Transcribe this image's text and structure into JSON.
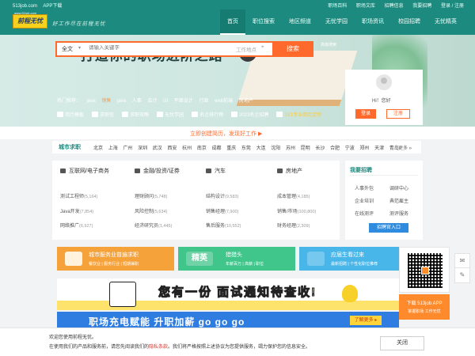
{
  "topbar": {
    "left": [
      "513job.com",
      "APP下载"
    ],
    "right": [
      "职场百科",
      "职场文库",
      "招聘信息",
      "我要招聘",
      "登录 / 注册"
    ]
  },
  "brand": {
    "url": "www.51job.com",
    "logo": "前程无忧",
    "slogan": "好工作尽在前程无忧"
  },
  "nav": [
    "首页",
    "职位搜索",
    "地区频道",
    "无忧学园",
    "职场资讯",
    "校园招聘",
    "无忧精英"
  ],
  "hero": {
    "title": "°打造你的职场进阶之路",
    "go": "Go",
    "search": {
      "category": "全文",
      "placeholder": "请输入关键字",
      "location": "工作地点",
      "button": "搜索",
      "advanced": "高级搜索"
    },
    "hot_label": "热门推荐：",
    "hot": [
      "java",
      "销售",
      "java",
      "人事",
      "会计",
      "UI",
      "平面设计",
      "行政",
      "web前端",
      "房地产"
    ],
    "hot_highlight_index": 1,
    "tools": [
      "简历模板",
      "求职信",
      "求职攻略",
      "无忧学园",
      "名企排行榜",
      "2023名企招聘",
      "1V1专业简历定制"
    ]
  },
  "login_card": {
    "greeting": "Hi！您好",
    "login": "登录",
    "register": "注册"
  },
  "create_resume": "立即创建简历，发现好工作 ▶",
  "cities": {
    "title": "城市求职",
    "list": [
      "北京",
      "上海",
      "广州",
      "深圳",
      "武汉",
      "西安",
      "杭州",
      "南京",
      "成都",
      "重庆",
      "东莞",
      "大连",
      "沈阳",
      "苏州",
      "昆明",
      "长沙",
      "合肥",
      "宁波",
      "郑州",
      "天津",
      "青岛"
    ],
    "more": "更多 »"
  },
  "industries": [
    {
      "name": "互联网/电子商务",
      "jobs": [
        [
          "测试工程师",
          "(5,164)"
        ],
        [
          "Java开发",
          "(7,854)"
        ],
        [
          "网络推广",
          "(6,927)"
        ]
      ]
    },
    {
      "name": "金融/投资/证券",
      "jobs": [
        [
          "理财顾问",
          "(5,748)"
        ],
        [
          "风险控制",
          "(5,634)"
        ],
        [
          "经济研究员",
          "(1,445)"
        ]
      ]
    },
    {
      "name": "汽车",
      "jobs": [
        [
          "结构设计",
          "(9,583)"
        ],
        [
          "销售经理",
          "(7,900)"
        ],
        [
          "售后服务",
          "(10,552)"
        ]
      ]
    },
    {
      "name": "房地产",
      "jobs": [
        [
          "成本管理",
          "(4,185)"
        ],
        [
          "销售/市场",
          "(100,800)"
        ],
        [
          "财务经理",
          "(2,309)"
        ]
      ]
    }
  ],
  "recruit": {
    "title": "我要招聘",
    "items": [
      "人事外包",
      "调研中心",
      "企业培训",
      "典范雇主",
      "在线测评",
      "测评服务"
    ],
    "button": "招聘官入口"
  },
  "banners": [
    {
      "title": "城市服务业普遍求职",
      "sub": "餐饮业 | 服务行业 | 短期兼职"
    },
    {
      "badge": "精英",
      "title": "猎猎头",
      "sub": "年薪百万 | 高薪 | 职位"
    },
    {
      "title": "应届生看过来",
      "sub": "最新招聘 | 个性化职位推荐"
    }
  ],
  "ad1": {
    "text": "您有一份 面试通知待查收!"
  },
  "ad2": {
    "text": "职场充电赋能  升职加薪 go go go",
    "button": "了解更多 ▸"
  },
  "side": {
    "download_title": "下载 513job APP",
    "download_sub": "掌握职场 工作无忧"
  },
  "cookie": {
    "line1": "欢迎您使用前程无忧。",
    "line2_pre": "在使用我们的产品和服务前，请您先阅读我们的",
    "line2_link": "隐私条款",
    "line2_post": "。我们将严格按照上述协议为您提供服务，竭力保护您的信息安全。",
    "close": "关闭"
  }
}
